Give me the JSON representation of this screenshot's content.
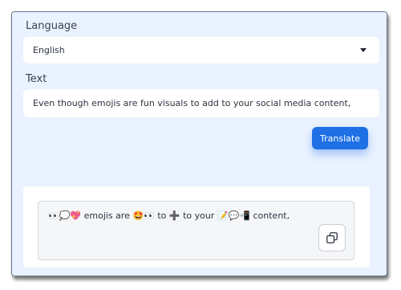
{
  "language": {
    "label": "Language",
    "selected": "English"
  },
  "text": {
    "label": "Text",
    "value": "Even though emojis are fun visuals to add to your social media content,"
  },
  "translate_button": "Translate",
  "output": {
    "segments": [
      {
        "type": "emoji",
        "value": "👀"
      },
      {
        "type": "emoji",
        "value": "💭"
      },
      {
        "type": "emoji",
        "value": "💖"
      },
      {
        "type": "text",
        "value": " emojis are "
      },
      {
        "type": "emoji",
        "value": "🤩"
      },
      {
        "type": "emoji",
        "value": "👀"
      },
      {
        "type": "text",
        "value": " to "
      },
      {
        "type": "emoji",
        "value": "➕"
      },
      {
        "type": "text",
        "value": " to your "
      },
      {
        "type": "emoji",
        "value": "📝"
      },
      {
        "type": "emoji",
        "value": "💬"
      },
      {
        "type": "emoji",
        "value": "📲"
      },
      {
        "type": "text",
        "value": " content,"
      }
    ]
  },
  "icons": {
    "dropdown": "chevron-down-icon",
    "copy": "copy-icon"
  },
  "colors": {
    "accent": "#1f70e5",
    "panel_background": "#e9f2fe"
  }
}
